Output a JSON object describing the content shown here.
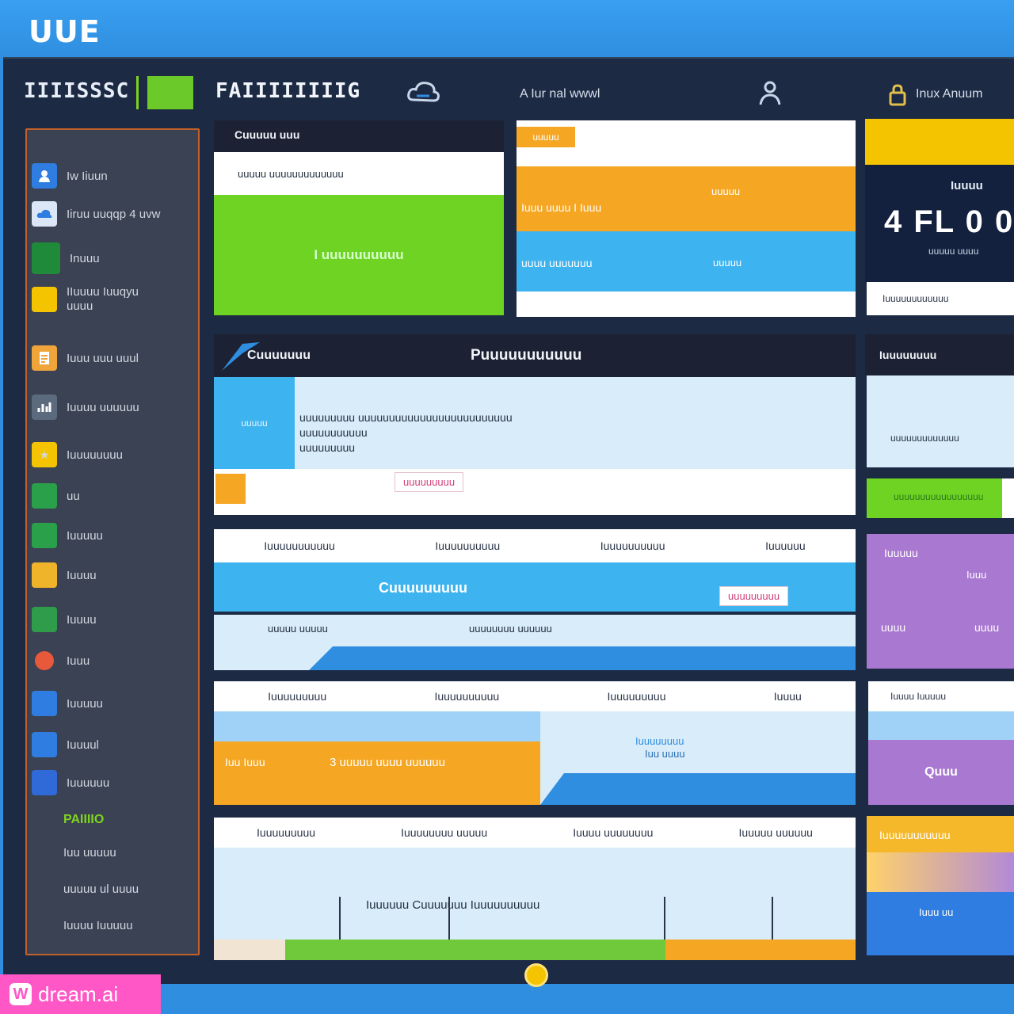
{
  "app": {
    "logo_text": "UUE"
  },
  "header": {
    "brand": "IIIISSSC",
    "brand_badge": "",
    "section_title": "FAIIIIIIIIG",
    "search_text": "A  Iur  nal  wwwl",
    "account_text": "Inux  Anuum",
    "icons": [
      "cloud-icon",
      "person-icon",
      "lock-icon"
    ]
  },
  "sidebar": {
    "items": [
      {
        "label": "Iw  Iiuun",
        "icon": "user-icon",
        "color": "#2f7de0"
      },
      {
        "label": "Iiruu  uuqqp  4  uvw",
        "icon": "cloud-icon",
        "color": "#dbe6f6"
      },
      {
        "label": "Inuuu",
        "icon": "square-icon",
        "color": "#1f8b3a"
      },
      {
        "label": "IIuuuu  Iuuqyu  uuuu",
        "icon": "folder-icon",
        "color": "#f5c400"
      },
      {
        "label": "Iuuu  uuu  uuul",
        "icon": "document-icon",
        "color": "#f0a53a"
      },
      {
        "label": "Iuuuu  uuuuuu",
        "icon": "chart-icon",
        "color": "#5c6a7d"
      },
      {
        "label": "Iuuuuuuuu",
        "icon": "star-icon",
        "color": "#f5c400"
      },
      {
        "label": "uu",
        "icon": "image-icon",
        "color": "#2aa04b"
      },
      {
        "label": "Iuuuuu",
        "icon": "grid-icon",
        "color": "#2aa04b"
      },
      {
        "label": "Iuuuu",
        "icon": "note-icon",
        "color": "#f0b42a"
      },
      {
        "label": "Iuuuu",
        "icon": "leaf-icon",
        "color": "#2e9c4a"
      },
      {
        "label": "Iuuu",
        "icon": "fire-icon",
        "color": "#e8583a"
      },
      {
        "label": "Iuuuuu",
        "icon": "globe-icon",
        "color": "#2f7de0"
      },
      {
        "label": "Iuuuul",
        "icon": "mail-icon",
        "color": "#2f7de0"
      },
      {
        "label": "Iuuuuuu",
        "icon": "settings-icon",
        "color": "#2f6ad8"
      }
    ],
    "section_label": "PAIIIIO",
    "bottom_items": [
      "Iuu  uuuuu",
      "uuuuu  ul  uuuu",
      "Iuuuu  Iuuuuu"
    ]
  },
  "cards": {
    "green_card": {
      "header": "Cuuuuu  uuu",
      "row": "uuuuu  uuuuuuuuuuuuu",
      "body": "I  uuuuuuuuuu"
    },
    "stack_card": {
      "tag": "uuuuu",
      "row_orange": "Iuuu  uuuu  I  Iuuu",
      "row_orange_right": "uuuuu",
      "row_blue": "uuuu  uuuuuuu",
      "row_blue_right": "uuuuu"
    },
    "stat_card": {
      "title": "Iuuuu",
      "value": "4 FL 0 0",
      "subtitle": "uuuuu  uuuu",
      "footer": "Iuuuuuuuuuuuu"
    }
  },
  "detail": {
    "header_left": "Cuuuuuuu",
    "header_center": "Puuuuuuuuuuu",
    "side_label": "uuuuu",
    "lines": [
      "uuuuuuuuu  uuuuuuuuuuuuuuuuuuuuuuuuu",
      "uuuuuuuuuuu",
      "uuuuuuuuu"
    ],
    "button": "uuuuuuuuu"
  },
  "right_panel": {
    "header": "Iuuuuuuuu",
    "row": "uuuuuuuuuuuuu",
    "progress": "uuuuuuuuuuuuuuuuu",
    "progress_pct": 92
  },
  "table1": {
    "tabs": [
      "Iuuuuuuuuuuu",
      "Iuuuuuuuuuu",
      "Iuuuuuuuuuu",
      "Iuuuuuu"
    ],
    "bar_text": "Cuuuuuuuuu",
    "bar_button": "uuuuuuuuu",
    "sub_left": "uuuuu  uuuuu",
    "sub_right": "uuuuuuuu  uuuuuu"
  },
  "purple_card": {
    "r1_left": "Iuuuuu",
    "r1_right": "Iuuu",
    "r2_left": "uuuu",
    "r2_right": "uuuu"
  },
  "table2": {
    "tabs": [
      "Iuuuuuuuuu",
      "Iuuuuuuuuuu",
      "Iuuuuuuuuu",
      "Iuuuu"
    ],
    "orange_left": "Iuu  Iuuu",
    "orange_right": "3  uuuuu  uuuu  uuuuuu",
    "blue_text": "Iuuuuuuuu",
    "blue_text2": "Iuu  uuuu"
  },
  "right_card2": {
    "header": "Iuuuu  Iuuuuu",
    "body": "Quuu"
  },
  "table3": {
    "tabs": [
      "Iuuuuuuuuu",
      "Iuuuuuuuu  uuuuu",
      "Iuuuu  uuuuuuuu",
      "Iuuuuu  uuuuuu"
    ],
    "caption": "Iuuuuuu  Cuuuuuuu  Iuuuuuuuuuu"
  },
  "right_card3": {
    "header": "Iuuuuuuuuuuu",
    "footer": "Iuuu  uu"
  },
  "watermark": {
    "mark": "W",
    "text": "dream.ai"
  }
}
